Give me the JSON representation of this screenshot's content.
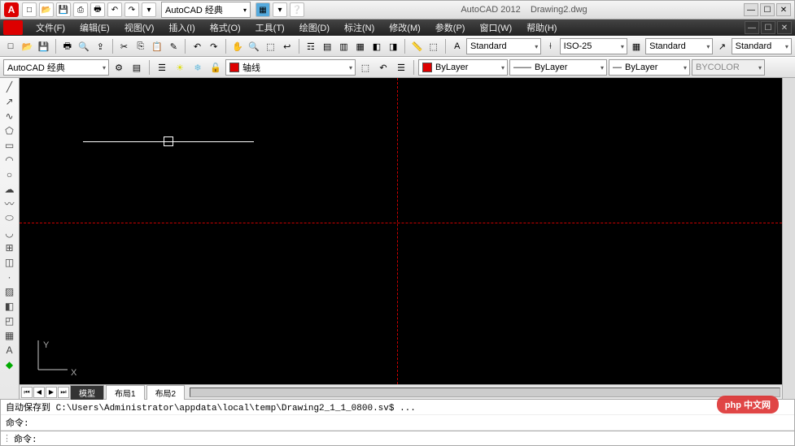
{
  "title": {
    "app": "AutoCAD 2012",
    "file": "Drawing2.dwg"
  },
  "qat_workspace": "AutoCAD 经典",
  "menu": [
    "文件(F)",
    "编辑(E)",
    "视图(V)",
    "插入(I)",
    "格式(O)",
    "工具(T)",
    "绘图(D)",
    "标注(N)",
    "修改(M)",
    "参数(P)",
    "窗口(W)",
    "帮助(H)"
  ],
  "row1": {
    "workspace": "AutoCAD 经典",
    "style1": "Standard",
    "dim": "ISO-25",
    "style2": "Standard",
    "style3": "Standard"
  },
  "row2": {
    "layer": "轴线",
    "layer_prop": "ByLayer",
    "lt": "ByLayer",
    "lw": "ByLayer",
    "color": "BYCOLOR"
  },
  "tabs": {
    "model": "模型",
    "l1": "布局1",
    "l2": "布局2"
  },
  "cmd": {
    "hist": "自动保存到 C:\\Users\\Administrator\\appdata\\local\\temp\\Drawing2_1_1_0800.sv$ ...",
    "prev": "命令:",
    "prompt": "命令:"
  },
  "ucs": {
    "x": "X",
    "y": "Y"
  },
  "watermark": "php 中文网",
  "icons": {
    "new": "□",
    "open": "⎘",
    "save": "💾",
    "saveall": "⎙",
    "plot": "⎙",
    "undo": "↶",
    "redo": "↷",
    "down": "▾",
    "search": "🔍",
    "grid": "▦",
    "help": "?",
    "min": "—",
    "max": "☐",
    "close": "✕"
  }
}
